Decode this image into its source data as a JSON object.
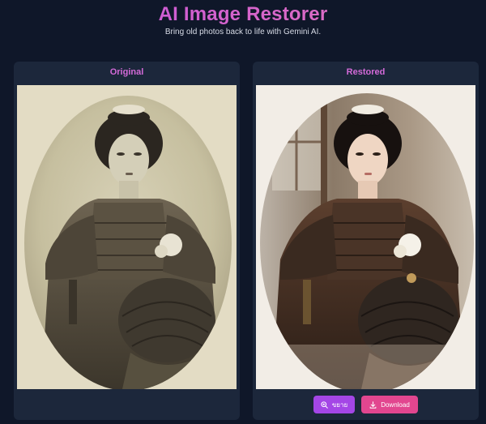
{
  "header": {
    "title": "AI Image Restorer",
    "subtitle": "Bring old photos back to life with Gemini AI."
  },
  "original_panel": {
    "title": "Original"
  },
  "restored_panel": {
    "title": "Restored",
    "zoom_label": "ขยาย",
    "download_label": "Download"
  },
  "colors": {
    "background": "#0f1729",
    "panel": "#1c273b",
    "title_gradient_start": "#c24fe0",
    "title_gradient_end": "#e879b8",
    "panel_title": "#d36ad8",
    "zoom_button": "#a446e6",
    "download_button": "#e2468f"
  },
  "icons": {
    "zoom": "zoom-in-icon",
    "download": "download-icon"
  }
}
